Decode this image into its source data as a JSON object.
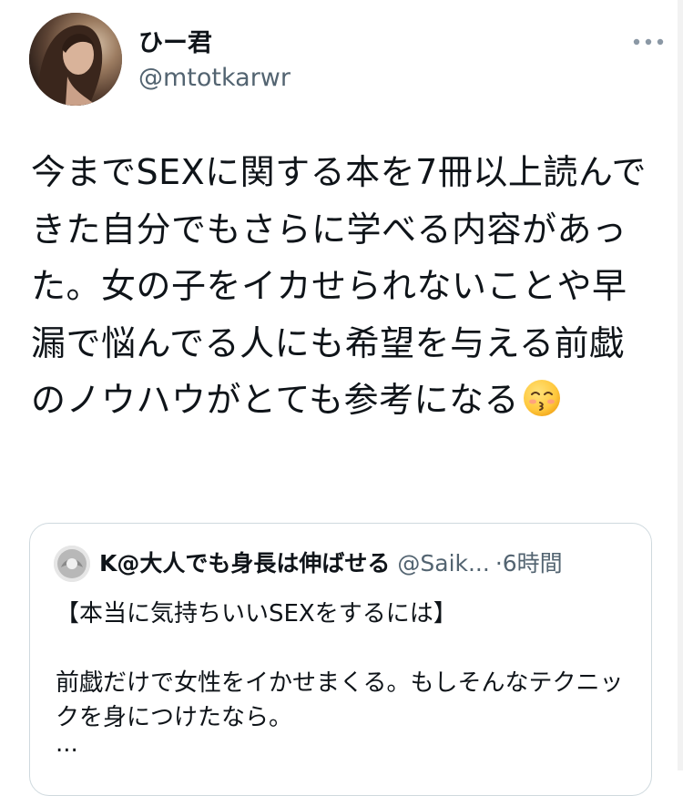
{
  "author": {
    "display_name": "ひー君",
    "handle": "@mtotkarwr"
  },
  "tweet": {
    "text": "今までSEXに関する本を7冊以上読んできた自分でもさらに学べる内容があった。女の子をイカせられないことや早漏で悩んでる人にも希望を与える前戯のノウハウがとても参考になる",
    "emoji": "kissing-face-emoji"
  },
  "quoted_tweet": {
    "display_name": "K@大人でも身長は伸ばせる",
    "handle": "@Saik...",
    "separator": "·",
    "time": "6時間",
    "lines": [
      "【本当に気持ちいいSEXをするには】",
      "",
      "前戯だけで女性をイかせまくる。もしそんなテクニックを身につけたなら。",
      "..."
    ]
  },
  "icons": {
    "more": "more-horizontal-icon"
  },
  "colors": {
    "text_primary": "#0f1419",
    "text_secondary": "#536471",
    "border": "#cfd9de"
  }
}
